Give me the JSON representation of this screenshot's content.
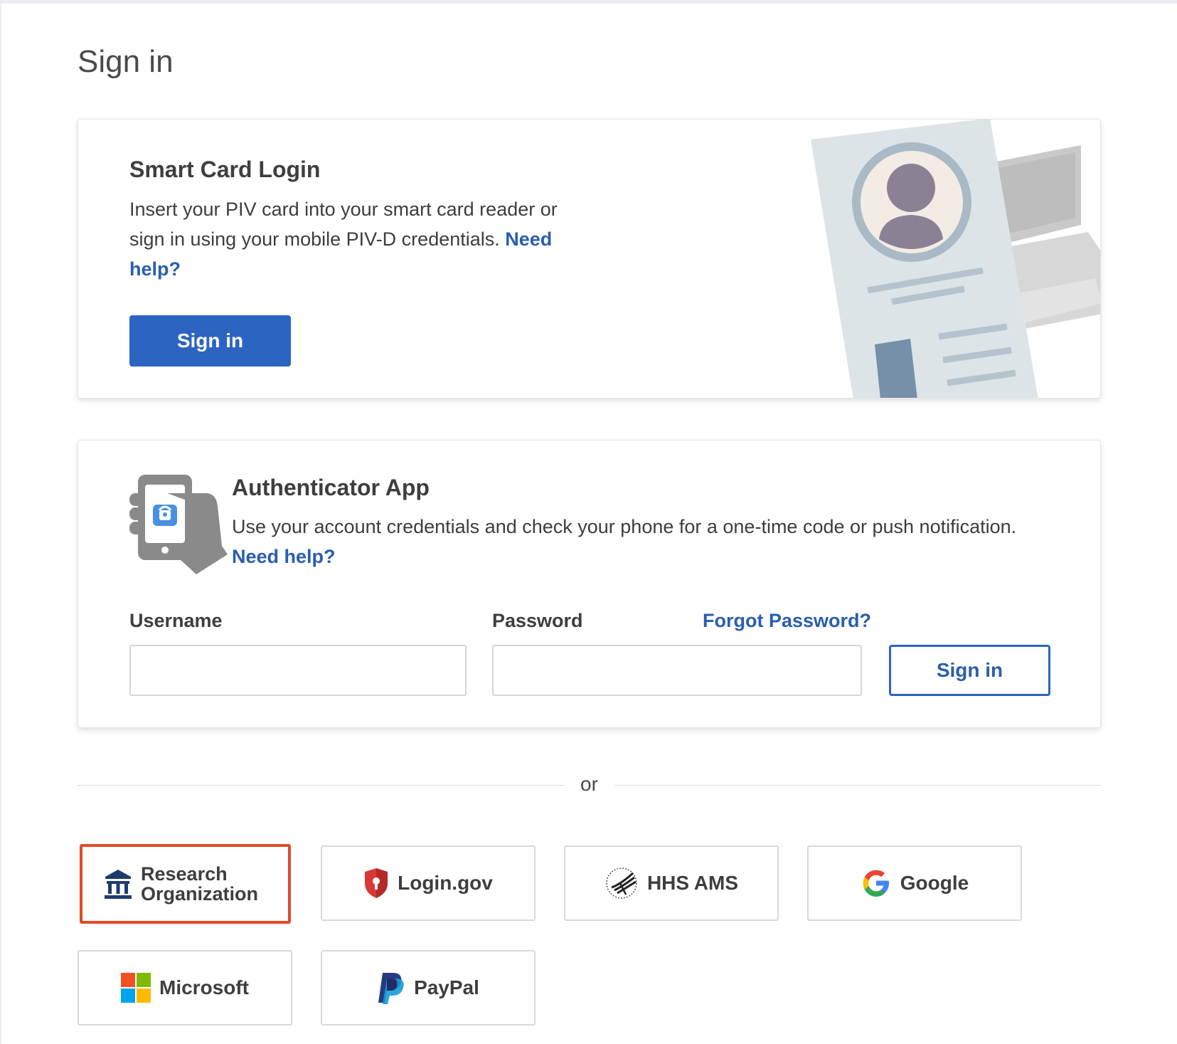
{
  "page": {
    "title": "Sign in"
  },
  "smart_card": {
    "title": "Smart Card Login",
    "description": "Insert your PIV card into your smart card reader or sign in using your mobile PIV-D credentials.",
    "help_link": "Need help?",
    "button_label": "Sign in"
  },
  "authenticator": {
    "title": "Authenticator App",
    "description": "Use your account credentials and check your phone for a one-time code or push notification.",
    "help_link": "Need help?",
    "username_label": "Username",
    "username_value": "",
    "password_label": "Password",
    "password_value": "",
    "forgot_password": "Forgot Password?",
    "button_label": "Sign in"
  },
  "divider": {
    "label": "or"
  },
  "providers": [
    {
      "label_line1": "Research",
      "label_line2": "Organization",
      "icon": "institution-icon"
    },
    {
      "label": "Login.gov",
      "icon": "login-gov-shield-icon"
    },
    {
      "label": "HHS AMS",
      "icon": "hhs-eagle-icon"
    },
    {
      "label": "Google",
      "icon": "google-icon"
    },
    {
      "label": "Microsoft",
      "icon": "microsoft-icon"
    },
    {
      "label": "PayPal",
      "icon": "paypal-icon"
    }
  ],
  "colors": {
    "primary": "#2c64c1",
    "link": "#2a5db0",
    "highlight": "#e14a2b"
  }
}
